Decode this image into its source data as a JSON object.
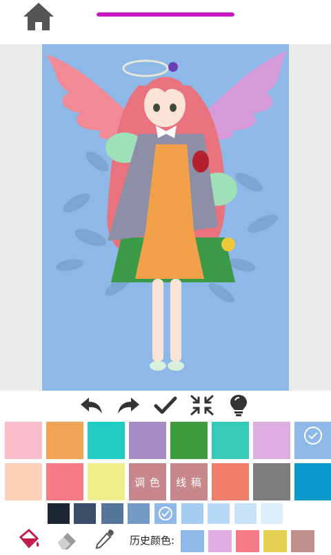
{
  "progress": {
    "fraction": 1.0,
    "color": "#c418c4"
  },
  "icons": {
    "home": "home-icon",
    "undo": "undo-icon",
    "redo": "redo-icon",
    "done": "checkmark-icon",
    "shrink": "collapse-icon",
    "hint": "lightbulb-icon",
    "fill": "paint-bucket-icon",
    "eraser": "eraser-icon",
    "picker": "eyedropper-icon"
  },
  "palette": {
    "row1": [
      "#f9bccb",
      "#f0a257",
      "#1fccc4",
      "#a68ac4",
      "#3f9c3c",
      "#35cbb8",
      "#ddaedf",
      "#8db8e8"
    ],
    "row2": [
      "#fdd1b9",
      "#f47a85",
      "#f0ed8c",
      "#c8878a",
      "#c8878a",
      "#f07d6a",
      "#7d7d7d",
      "#0c99cc"
    ],
    "selected_index": 7,
    "mix_label": "调 色",
    "lineart_label": "线 稿"
  },
  "shades": {
    "colors": [
      "#1c2635",
      "#3b4e68",
      "#567699",
      "#749bc6",
      "#8db8e8",
      "#a4cbf2",
      "#b6d7f6",
      "#c9e2f9",
      "#dcedfc"
    ],
    "selected_index": 4
  },
  "history": {
    "label": "历史颜色:",
    "colors": [
      "#8db8e8",
      "#ddaedf",
      "#f47a85",
      "#e6cf56",
      "#c08f8c"
    ]
  }
}
